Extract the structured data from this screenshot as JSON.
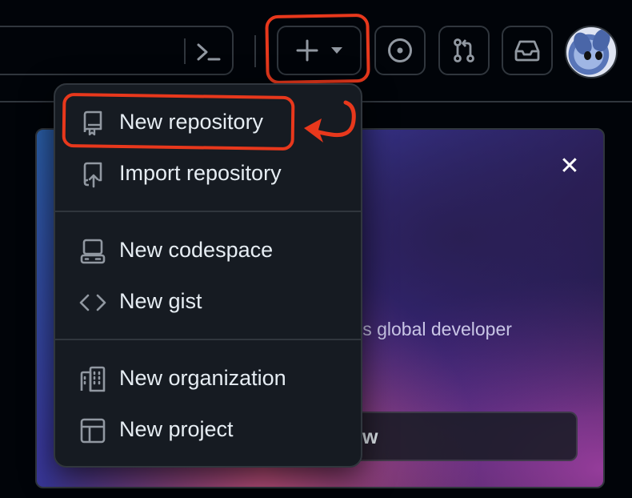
{
  "header": {
    "create_menu_icons": [
      "plus-icon",
      "triangle-down-icon"
    ],
    "action_icons": [
      "issue-opened-icon",
      "git-pull-request-icon",
      "inbox-icon"
    ],
    "command_palette_icon": "terminal-icon"
  },
  "menu": {
    "items": [
      {
        "label": "New repository",
        "icon": "repo-icon"
      },
      {
        "label": "Import repository",
        "icon": "repo-push-icon"
      },
      {
        "label": "New codespace",
        "icon": "codespaces-icon"
      },
      {
        "label": "New gist",
        "icon": "code-icon"
      },
      {
        "label": "New organization",
        "icon": "organization-icon"
      },
      {
        "label": "New project",
        "icon": "table-icon"
      }
    ]
  },
  "promo": {
    "text": "r’s global developer",
    "button_label": "w",
    "close_icon": "x-icon"
  },
  "colors": {
    "background": "#010409",
    "border": "#30363d",
    "menu_bg": "#161b22",
    "text": "#e6edf3",
    "icon": "#9198a1",
    "annotation": "#e8381c"
  }
}
